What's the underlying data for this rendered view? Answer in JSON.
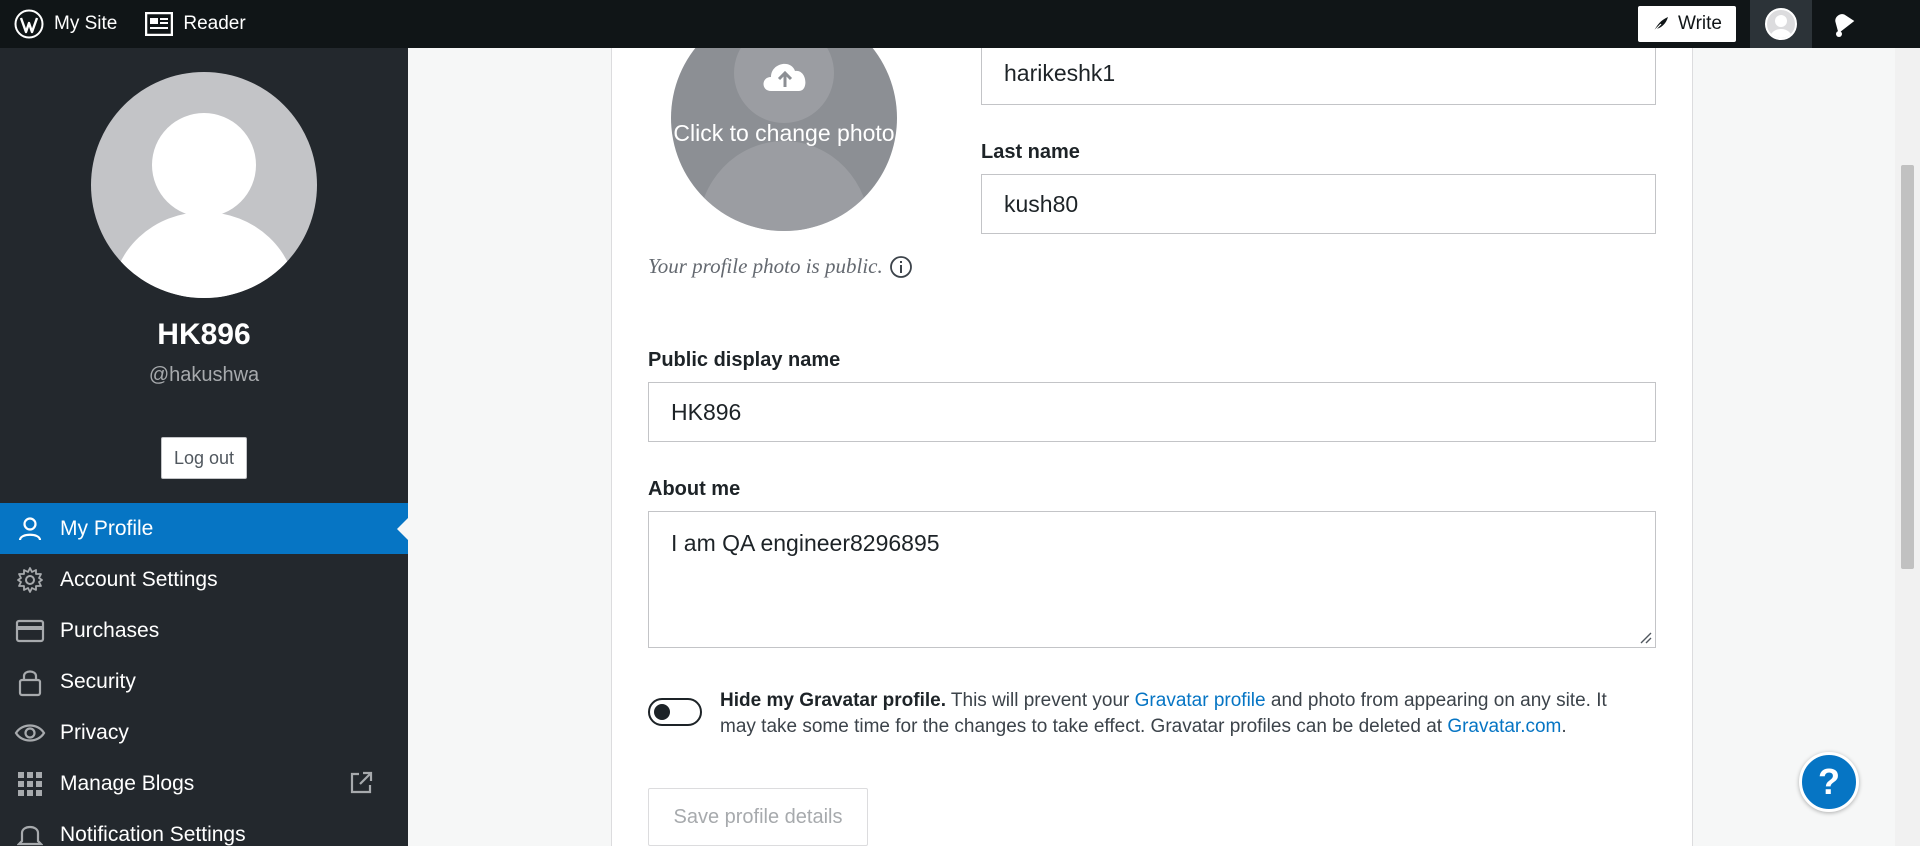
{
  "masterbar": {
    "my_site_label": "My Site",
    "reader_label": "Reader",
    "write_label": "Write"
  },
  "sidebar": {
    "display_name": "HK896",
    "handle": "@hakushwa",
    "logout_label": "Log out",
    "items": [
      {
        "label": "My Profile",
        "icon": "person-icon",
        "active": true
      },
      {
        "label": "Account Settings",
        "icon": "gear-icon"
      },
      {
        "label": "Purchases",
        "icon": "credit-card-icon"
      },
      {
        "label": "Security",
        "icon": "lock-icon"
      },
      {
        "label": "Privacy",
        "icon": "eye-icon"
      },
      {
        "label": "Manage Blogs",
        "icon": "grid-icon",
        "external": true
      },
      {
        "label": "Notification Settings",
        "icon": "bell-icon"
      }
    ]
  },
  "profile": {
    "photo_label": "Click to change photo",
    "photo_public_note": "Your profile photo is public.",
    "first_name_value": "harikeshk1",
    "last_name_label": "Last name",
    "last_name_value": "kush80",
    "display_name_label": "Public display name",
    "display_name_value": "HK896",
    "about_label": "About me",
    "about_value": "I am QA engineer8296895",
    "hide_gravatar_bold": "Hide my Gravatar profile.",
    "hide_gravatar_text1": " This will prevent your ",
    "gravatar_profile_link": "Gravatar profile",
    "hide_gravatar_text2": " and photo from appearing on any site. It may take some time for the changes to take effect. Gravatar profiles can be deleted at ",
    "gravatar_com_link": "Gravatar.com",
    "hide_gravatar_text3": ".",
    "hide_gravatar_on": false,
    "save_label": "Save profile details"
  },
  "help": {
    "label": "?"
  },
  "colors": {
    "accent": "#0675c4",
    "sidebar_bg": "#23282d",
    "masterbar_bg": "#101517"
  }
}
